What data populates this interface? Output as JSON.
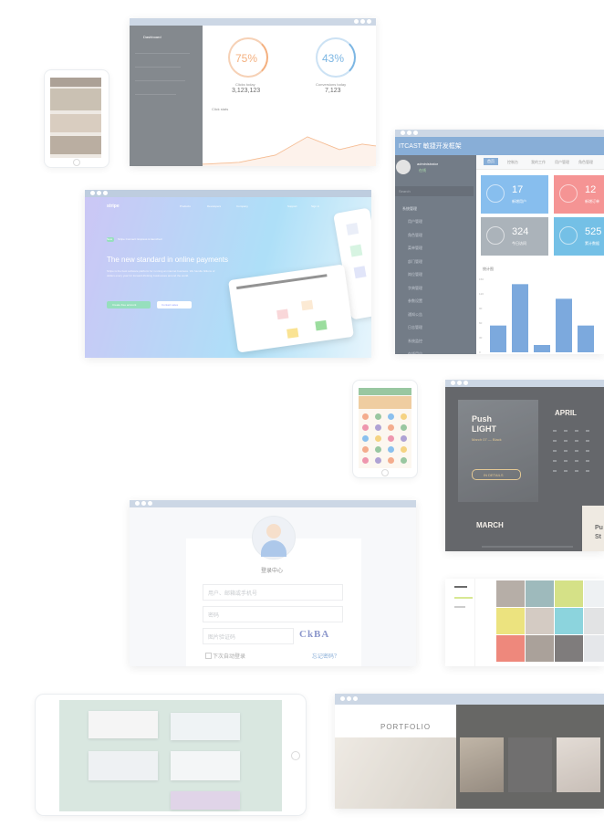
{
  "dashboard": {
    "nav_title": "Dashboard",
    "stats": [
      {
        "percent": "75%",
        "label": "Clicks today",
        "value": "3,123,123",
        "color": "#f0924e"
      },
      {
        "percent": "43%",
        "label": "Conversions today",
        "value": "7,123",
        "color": "#4a9bd9"
      }
    ],
    "chart_title": "Click stats"
  },
  "admin": {
    "brand": "ITCAST 敏捷开发框架",
    "user": "administrator",
    "status": "在线",
    "search_placeholder": "Search",
    "menu_title": "系统管理",
    "menu_items": [
      "用户管理",
      "角色管理",
      "菜单管理",
      "部门管理",
      "岗位管理",
      "字典管理",
      "参数设置",
      "通知公告",
      "日志管理",
      "系统监控",
      "在线用户"
    ],
    "tabs": [
      "首页",
      "控制台",
      "我的工作",
      "用户管理",
      "角色管理"
    ],
    "tiles": [
      {
        "value": "17",
        "label": "新增用户",
        "color": "#5aa6e8"
      },
      {
        "value": "12",
        "label": "新增订单",
        "color": "#f26b6b"
      },
      {
        "value": "324",
        "label": "今日访问",
        "color": "#8c96a0"
      },
      {
        "value": "525",
        "label": "累计数据",
        "color": "#3fa9dd"
      }
    ],
    "chart_title": "统计图",
    "colors": {
      "sidebar": "#3e4a5a",
      "header": "#5b8fc9",
      "bars": "#4a89d1"
    },
    "chart_data": {
      "type": "bar",
      "categories": [
        "1",
        "2",
        "3",
        "4",
        "5"
      ],
      "values": [
        55,
        140,
        15,
        110,
        55
      ],
      "ylim": [
        0,
        150
      ],
      "grid": false
    }
  },
  "stripe": {
    "logo": "stripe",
    "nav": [
      "Products",
      "Developers",
      "Company",
      "Support",
      "Sign in"
    ],
    "badge": "New",
    "badge_text": "Stripe Connect: Express is launched",
    "headline": "The new standard in online payments",
    "body": "Stripe is the best software platform for running an internet business. We handle billions of dollars every year for forward-thinking businesses around the world.",
    "cta_primary": "Create free account",
    "cta_secondary": "Contact sales"
  },
  "calendar": {
    "push": "Push",
    "light": "LIGHT",
    "date": "March 07 — Black",
    "details": "IN DETAILS",
    "april": "APRIL",
    "march": "MARCH",
    "push2": "Pu",
    "st": "St"
  },
  "login": {
    "title": "登录中心",
    "username_placeholder": "用户、邮箱或手机号",
    "password_placeholder": "密码",
    "captcha_placeholder": "图片验证码",
    "captcha_text": "CkBA",
    "remember": "下次自动登录",
    "forgot": "忘记密码？"
  },
  "portfolio": {
    "heading": "PORTFOLIO"
  }
}
